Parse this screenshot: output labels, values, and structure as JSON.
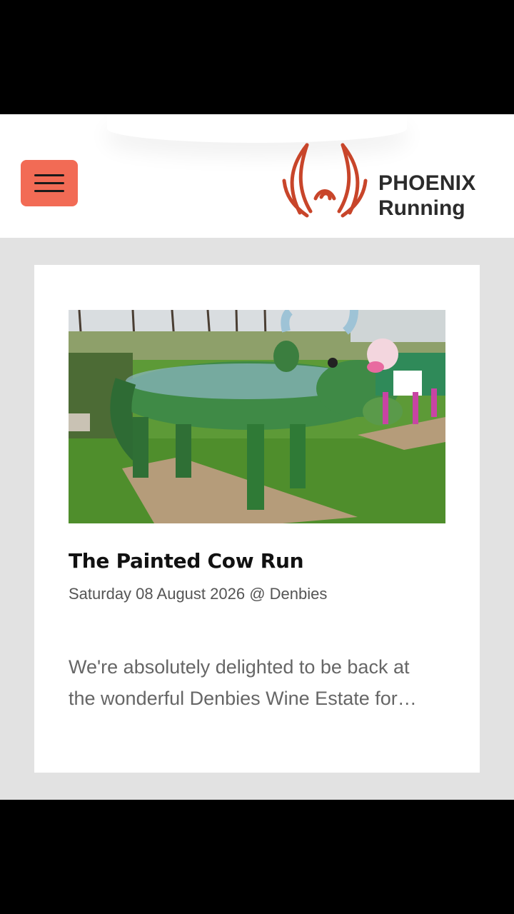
{
  "header": {
    "menu_icon": "hamburger-menu-icon",
    "logo": {
      "line1": "PHOENIX",
      "line2": "Running",
      "icon": "phoenix-logo-icon",
      "color": "#c8452a"
    }
  },
  "event_card": {
    "image_alt": "Painted cow sculptures on grass at Denbies",
    "title": "The Painted Cow Run",
    "meta": "Saturday 08 August 2026 @ Denbies",
    "excerpt": "We're absolutely delighted to be back at the wonderful Denbies Wine Estate for…"
  },
  "colors": {
    "accent": "#f26b55",
    "background": "#e2e2e2",
    "card": "#ffffff"
  }
}
